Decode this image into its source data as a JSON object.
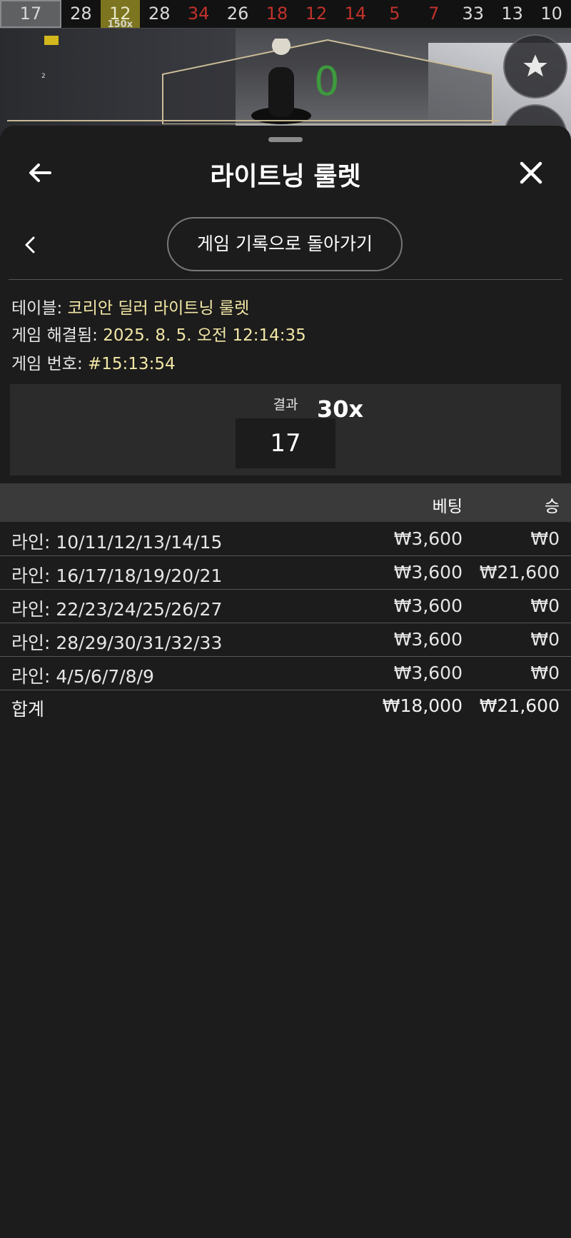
{
  "history": {
    "current": "17",
    "numbers": [
      {
        "n": "28",
        "color": "white"
      },
      {
        "n": "12",
        "color": "lit",
        "mult": "150x"
      },
      {
        "n": "28",
        "color": "white"
      },
      {
        "n": "34",
        "color": "red"
      },
      {
        "n": "26",
        "color": "white"
      },
      {
        "n": "18",
        "color": "red"
      },
      {
        "n": "12",
        "color": "red"
      },
      {
        "n": "14",
        "color": "red"
      },
      {
        "n": "5",
        "color": "red"
      },
      {
        "n": "7",
        "color": "red"
      },
      {
        "n": "33",
        "color": "white"
      },
      {
        "n": "13",
        "color": "white"
      },
      {
        "n": "10",
        "color": "white"
      }
    ]
  },
  "game_bg": {
    "flag_label": "2",
    "zero": "0"
  },
  "sheet": {
    "title": "라이트닝 룰렛",
    "back_history_label": "게임 기록으로 돌아가기"
  },
  "info": {
    "table_label": "테이블:",
    "table_value": "코리안 딜러 라이트닝 룰렛",
    "resolved_label": "게임 해결됨:",
    "resolved_value": "2025. 8. 5. 오전 12:14:35",
    "number_label": "게임 번호:",
    "number_value": "#15:13:54"
  },
  "result": {
    "label": "결과",
    "value": "17",
    "multiplier": "30x"
  },
  "bets_table": {
    "headers": {
      "bet": "베팅",
      "win": "승"
    },
    "rows": [
      {
        "label": "라인: 10/11/12/13/14/15",
        "bet": "₩3,600",
        "win": "₩0"
      },
      {
        "label": "라인: 16/17/18/19/20/21",
        "bet": "₩3,600",
        "win": "₩21,600"
      },
      {
        "label": "라인: 22/23/24/25/26/27",
        "bet": "₩3,600",
        "win": "₩0"
      },
      {
        "label": "라인: 28/29/30/31/32/33",
        "bet": "₩3,600",
        "win": "₩0"
      },
      {
        "label": "라인: 4/5/6/7/8/9",
        "bet": "₩3,600",
        "win": "₩0"
      }
    ],
    "total": {
      "label": "합계",
      "bet": "₩18,000",
      "win": "₩21,600"
    }
  },
  "colors": {
    "accent_value": "#f2e7a6",
    "red_number": "#c0322c",
    "green_zero": "#3d9a3d",
    "lit_cell": "#7d7520"
  }
}
